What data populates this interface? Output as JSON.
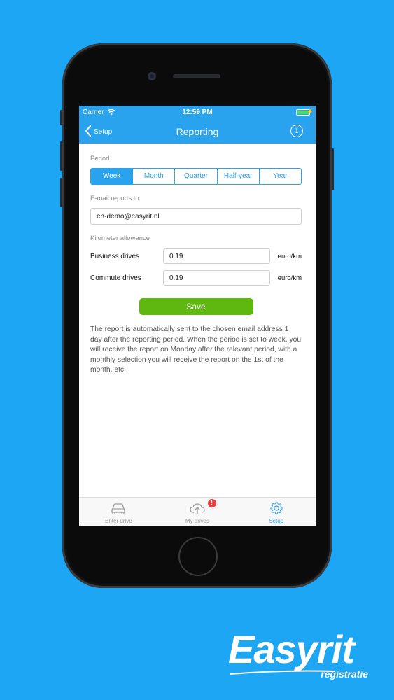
{
  "status_bar": {
    "carrier": "Carrier",
    "time": "12:59 PM",
    "battery_level": 1.0
  },
  "nav": {
    "back_label": "Setup",
    "title": "Reporting",
    "info_icon": "info-icon",
    "info_glyph": "i"
  },
  "period": {
    "label": "Period",
    "options": [
      "Week",
      "Month",
      "Quarter",
      "Half-year",
      "Year"
    ],
    "selected": "Week"
  },
  "email": {
    "label": "E-mail reports to",
    "value": "en-demo@easyrit.nl"
  },
  "allowance": {
    "label": "Kilometer allowance",
    "rows": [
      {
        "label": "Business drives",
        "value": "0.19",
        "unit": "euro/km"
      },
      {
        "label": "Commute drives",
        "value": "0.19",
        "unit": "euro/km"
      }
    ]
  },
  "save_label": "Save",
  "description": "The report is automatically sent to the chosen email address 1 day after the reporting period. When the period is set to week, you will receive the report on Monday after the relevant period, with a monthly selection you will receive the report on the 1st of the month, etc.",
  "tabs": [
    {
      "label": "Enter drive",
      "icon": "car-icon"
    },
    {
      "label": "My drives",
      "icon": "cloud-upload-icon",
      "badge": "!"
    },
    {
      "label": "Setup",
      "icon": "gear-icon"
    }
  ],
  "active_tab": "Setup",
  "logo": {
    "word": "Easyrit",
    "sub": "registratie"
  },
  "colors": {
    "background": "#1da6f3",
    "accent": "#2aa3ee",
    "save": "#5fb80f",
    "badge": "#ee3b3b"
  }
}
